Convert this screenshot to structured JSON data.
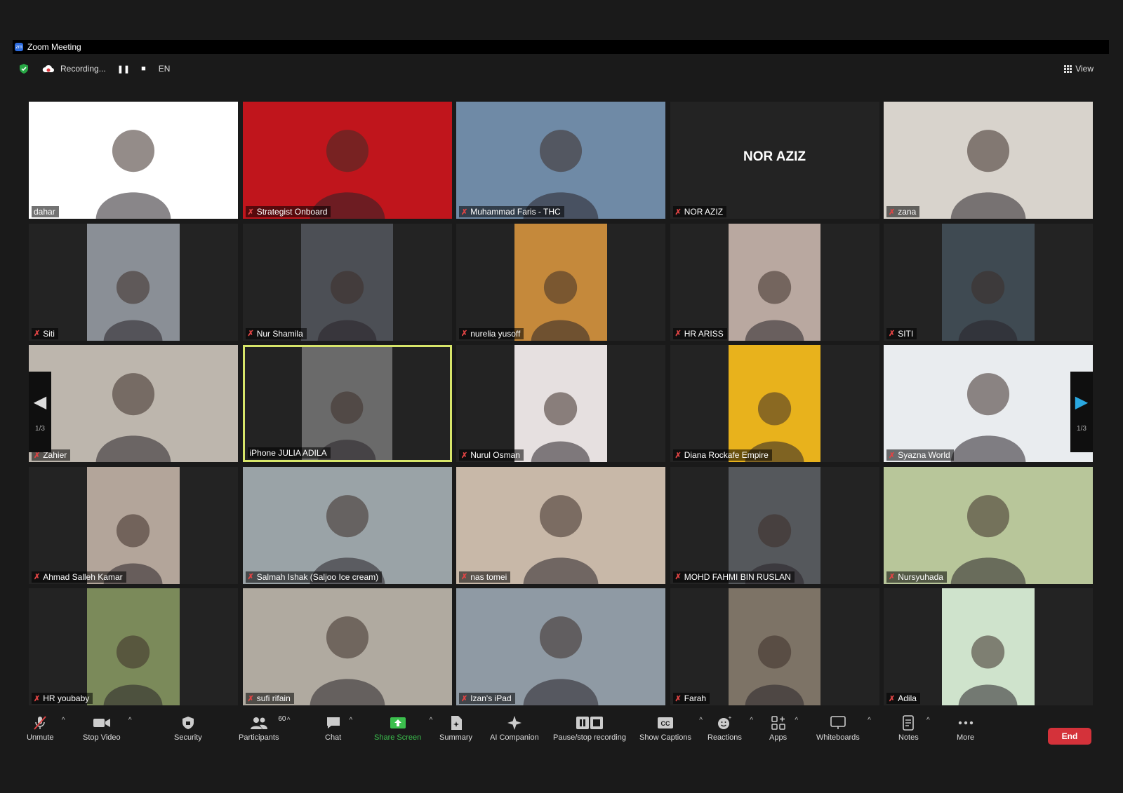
{
  "window": {
    "title": "Zoom Meeting"
  },
  "status": {
    "recording_label": "Recording...",
    "language": "EN",
    "view_label": "View"
  },
  "pager": {
    "left_label": "1/3",
    "right_label": "1/3"
  },
  "tiles": [
    {
      "name": "dahar",
      "muted": false,
      "active": false,
      "bg": "#ffffff",
      "layout": "full"
    },
    {
      "name": "Strategist Onboard",
      "muted": true,
      "active": false,
      "bg": "#c0151c",
      "layout": "full"
    },
    {
      "name": "Muhammad Faris - THC",
      "muted": true,
      "active": false,
      "bg": "#6f8aa6",
      "layout": "full"
    },
    {
      "name": "NOR AZIZ",
      "muted": true,
      "active": false,
      "bg": "#232323",
      "layout": "none",
      "display_name": "NOR AZIZ"
    },
    {
      "name": "zana",
      "muted": true,
      "active": false,
      "bg": "#d8d3cc",
      "layout": "full"
    },
    {
      "name": "Siti",
      "muted": true,
      "active": false,
      "bg": "#8a8f96",
      "layout": "center"
    },
    {
      "name": "Nur Shamila",
      "muted": true,
      "active": false,
      "bg": "#4c4f55",
      "layout": "center"
    },
    {
      "name": "nurelia yusoff",
      "muted": true,
      "active": false,
      "bg": "#c5893b",
      "layout": "center"
    },
    {
      "name": "HR ARISS",
      "muted": true,
      "active": false,
      "bg": "#b9a8a0",
      "layout": "center"
    },
    {
      "name": "SITI",
      "muted": true,
      "active": false,
      "bg": "#3f4a52",
      "layout": "center"
    },
    {
      "name": "Zahier",
      "muted": true,
      "active": false,
      "bg": "#bdb6ad",
      "layout": "full"
    },
    {
      "name": "iPhone JULIA ADILA",
      "muted": false,
      "active": true,
      "bg": "#6a6a6a",
      "layout": "center"
    },
    {
      "name": "Nurul Osman",
      "muted": true,
      "active": false,
      "bg": "#e6e0e0",
      "layout": "center"
    },
    {
      "name": "Diana Rockafe Empire",
      "muted": true,
      "active": false,
      "bg": "#e8b21c",
      "layout": "center"
    },
    {
      "name": "Syazna World",
      "muted": true,
      "active": false,
      "bg": "#e9ecef",
      "layout": "full"
    },
    {
      "name": "Ahmad Salleh Kamar",
      "muted": true,
      "active": false,
      "bg": "#b3a59a",
      "layout": "center"
    },
    {
      "name": "Salmah Ishak (Saljoo Ice cream)",
      "muted": true,
      "active": false,
      "bg": "#9aa3a7",
      "layout": "full"
    },
    {
      "name": "nas tomei",
      "muted": true,
      "active": false,
      "bg": "#c8b8a8",
      "layout": "full"
    },
    {
      "name": "MOHD FAHMI BIN RUSLAN",
      "muted": true,
      "active": false,
      "bg": "#55585c",
      "layout": "center"
    },
    {
      "name": "Nursyuhada",
      "muted": true,
      "active": false,
      "bg": "#b8c69a",
      "layout": "full"
    },
    {
      "name": "HR youbaby",
      "muted": true,
      "active": false,
      "bg": "#7b8a5a",
      "layout": "center"
    },
    {
      "name": "sufi rifain",
      "muted": true,
      "active": false,
      "bg": "#b0aaa0",
      "layout": "full"
    },
    {
      "name": "Izan's iPad",
      "muted": true,
      "active": false,
      "bg": "#8f9aa4",
      "layout": "full"
    },
    {
      "name": "Farah",
      "muted": true,
      "active": false,
      "bg": "#7d7366",
      "layout": "center"
    },
    {
      "name": "Adila",
      "muted": true,
      "active": false,
      "bg": "#cfe3cc",
      "layout": "center"
    }
  ],
  "toolbar": {
    "unmute": "Unmute",
    "stop_video": "Stop Video",
    "security": "Security",
    "participants": "Participants",
    "participants_count": "60",
    "chat": "Chat",
    "share": "Share Screen",
    "summary": "Summary",
    "ai": "AI Companion",
    "pause": "Pause/stop recording",
    "captions": "Show Captions",
    "reactions": "Reactions",
    "apps": "Apps",
    "whiteboards": "Whiteboards",
    "notes": "Notes",
    "more": "More",
    "end": "End"
  }
}
